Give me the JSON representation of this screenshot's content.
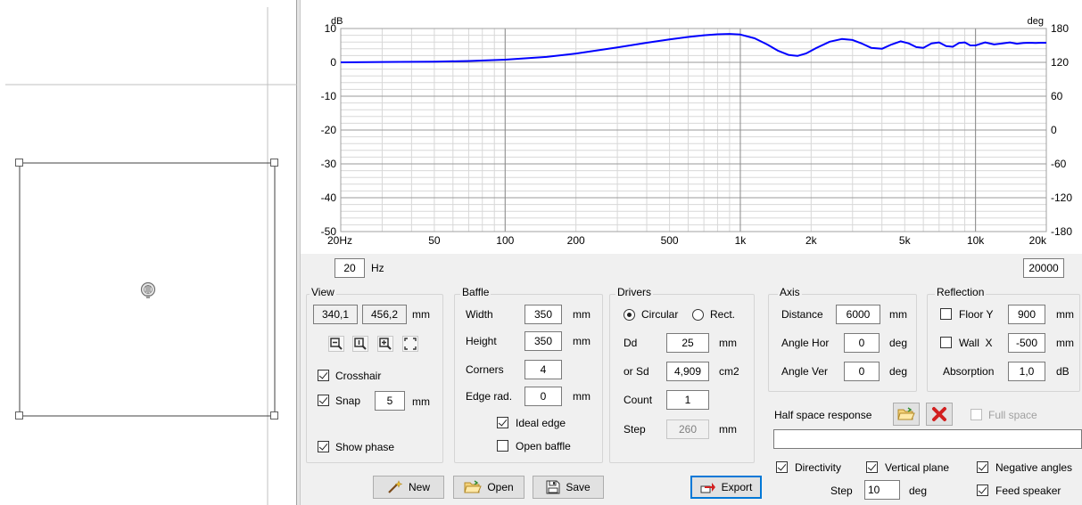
{
  "chart_data": {
    "type": "line",
    "title": "",
    "y_unit_left": "dB",
    "y_unit_right": "deg",
    "xscale": "log",
    "xlim": [
      20,
      20000
    ],
    "ylim_left": [
      -50,
      10
    ],
    "ylim_right": [
      -180,
      180
    ],
    "x_tick_labels": [
      "20Hz",
      "50",
      "100",
      "200",
      "500",
      "1k",
      "2k",
      "5k",
      "10k",
      "20k"
    ],
    "y_left_ticks": [
      "10",
      "0",
      "-10",
      "-20",
      "-30",
      "-40",
      "-50"
    ],
    "y_right_ticks": [
      "180",
      "120",
      "60",
      "0",
      "-60",
      "-120",
      "-180"
    ],
    "grid": true,
    "series": [
      {
        "color": "#0000ff",
        "x": [
          20,
          30,
          50,
          70,
          100,
          150,
          200,
          300,
          400,
          500,
          600,
          700,
          800,
          900,
          1000,
          1150,
          1300,
          1450,
          1600,
          1750,
          1900,
          2100,
          2400,
          2700,
          3000,
          3300,
          3600,
          4000,
          4400,
          4800,
          5200,
          5600,
          6000,
          6500,
          7000,
          7500,
          8000,
          8500,
          9000,
          9500,
          10000,
          11000,
          12000,
          13000,
          14000,
          15000,
          16000,
          17000,
          18000,
          19000,
          20000
        ],
        "y": [
          0.0,
          0.1,
          0.2,
          0.4,
          0.8,
          1.6,
          2.6,
          4.4,
          5.8,
          6.8,
          7.5,
          8.0,
          8.3,
          8.4,
          8.2,
          7.1,
          5.3,
          3.4,
          2.2,
          1.9,
          2.6,
          4.2,
          6.1,
          6.9,
          6.6,
          5.5,
          4.3,
          4.0,
          5.3,
          6.2,
          5.6,
          4.5,
          4.3,
          5.6,
          5.9,
          4.8,
          4.6,
          5.7,
          5.9,
          5.0,
          5.0,
          5.9,
          5.3,
          5.6,
          5.9,
          5.5,
          5.7,
          5.8,
          5.7,
          5.8,
          5.8
        ]
      }
    ]
  },
  "freq": {
    "min": "20",
    "unit": "Hz",
    "max": "20000"
  },
  "view": {
    "title": "View",
    "x": "340,1",
    "y": "456,2",
    "unit": "mm",
    "crosshair": "Crosshair",
    "snap": "Snap",
    "snap_value": "5",
    "snap_unit": "mm",
    "show_phase": "Show phase"
  },
  "baffle": {
    "title": "Baffle",
    "width_label": "Width",
    "width": "350",
    "width_unit": "mm",
    "height_label": "Height",
    "height": "350",
    "height_unit": "mm",
    "corners_label": "Corners",
    "corners": "4",
    "edge_label": "Edge rad.",
    "edge": "0",
    "edge_unit": "mm",
    "ideal_edge": "Ideal edge",
    "open_baffle": "Open baffle"
  },
  "drivers": {
    "title": "Drivers",
    "circular": "Circular",
    "rect": "Rect.",
    "dd_label": "Dd",
    "dd": "25",
    "dd_unit": "mm",
    "sd_label": "or Sd",
    "sd": "4,909",
    "sd_unit": "cm2",
    "count_label": "Count",
    "count": "1",
    "step_label": "Step",
    "step": "260",
    "step_unit": "mm"
  },
  "axis": {
    "title": "Axis",
    "distance_label": "Distance",
    "distance": "6000",
    "distance_unit": "mm",
    "hor_label": "Angle Hor",
    "hor": "0",
    "hor_unit": "deg",
    "ver_label": "Angle Ver",
    "ver": "0",
    "ver_unit": "deg"
  },
  "reflection": {
    "title": "Reflection",
    "floor_label": "Floor Y",
    "floor": "900",
    "floor_unit": "mm",
    "wall_label": "Wall  X",
    "wall": "-500",
    "wall_unit": "mm",
    "absorption_label": "Absorption",
    "absorption": "1,0",
    "absorption_unit": "dB"
  },
  "half_space": {
    "label": "Half space response",
    "full_space": "Full space",
    "path": ""
  },
  "options": {
    "directivity": "Directivity",
    "vertical_plane": "Vertical plane",
    "negative_angles": "Negative angles",
    "step_label": "Step",
    "step": "10",
    "step_unit": "deg",
    "feed_speaker": "Feed speaker"
  },
  "buttons": {
    "new": "New",
    "open": "Open",
    "save": "Save",
    "export": "Export"
  },
  "colors": {
    "curve": "#0000ff",
    "accent": "#0078d7",
    "delete": "#d21f1f",
    "folder": "#e8b84a"
  }
}
